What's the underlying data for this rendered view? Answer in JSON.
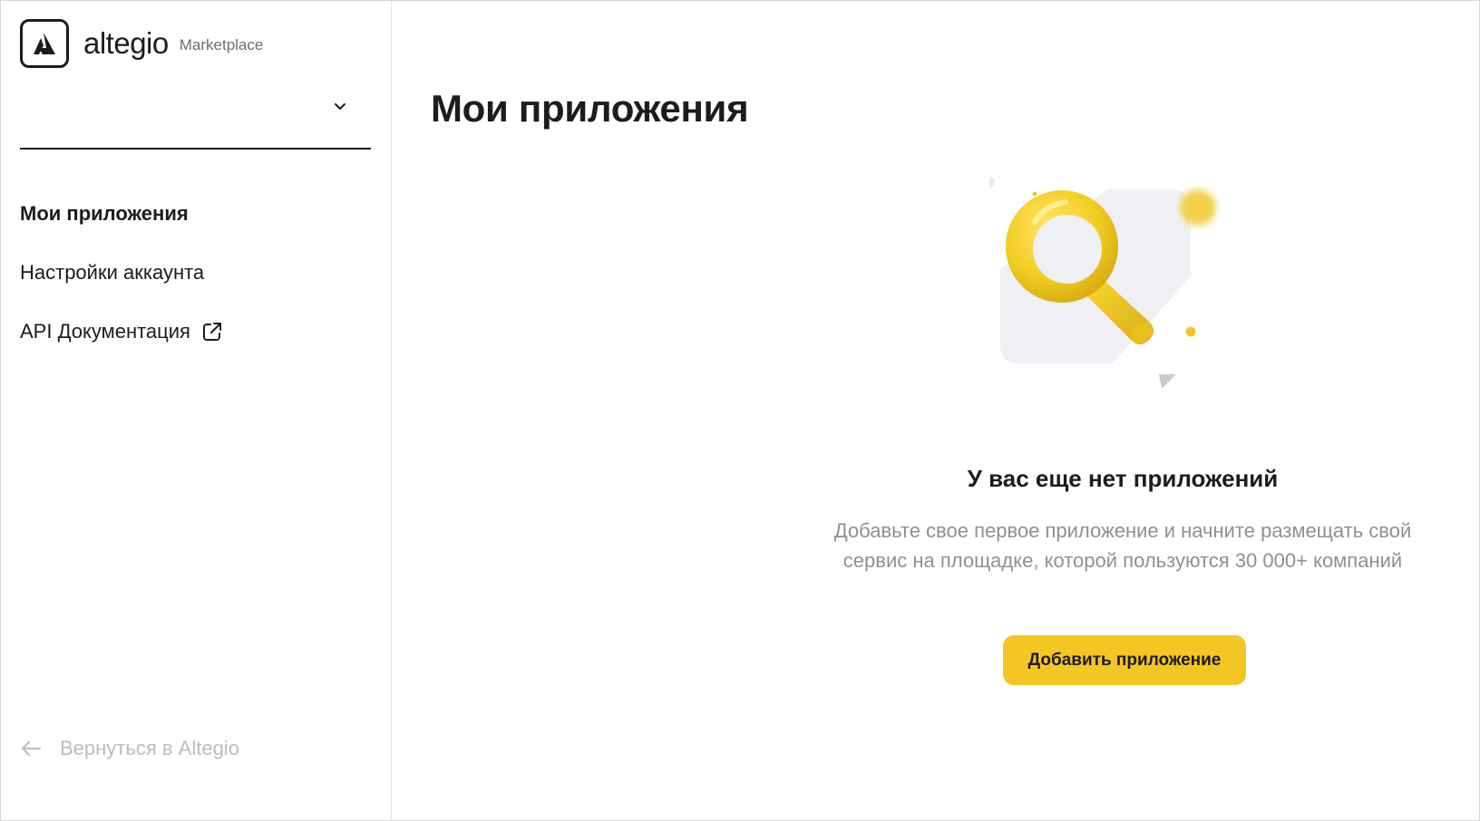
{
  "brand": {
    "name": "altegio",
    "product": "Marketplace"
  },
  "sidebar": {
    "select": {
      "value": ""
    },
    "items": [
      {
        "label": "Мои приложения",
        "active": true
      },
      {
        "label": "Настройки аккаунта",
        "active": false
      },
      {
        "label": "API Документация",
        "active": false,
        "icon": "external-link-icon"
      }
    ],
    "back_label": "Вернуться в Altegio"
  },
  "main": {
    "title": "Мои приложения",
    "empty_state": {
      "title": "У вас еще нет приложений",
      "description_line1": "Добавьте свое первое приложение и начните размещать свой",
      "description_line2": "сервис на площадке, которой пользуются 30 000+ компаний",
      "button_label": "Добавить приложение",
      "illustration": "magnifier-illustration"
    }
  },
  "colors": {
    "accent": "#f3c623",
    "text": "#1c1c1e",
    "muted": "#8e9097",
    "disabled": "#b8bcc4"
  }
}
